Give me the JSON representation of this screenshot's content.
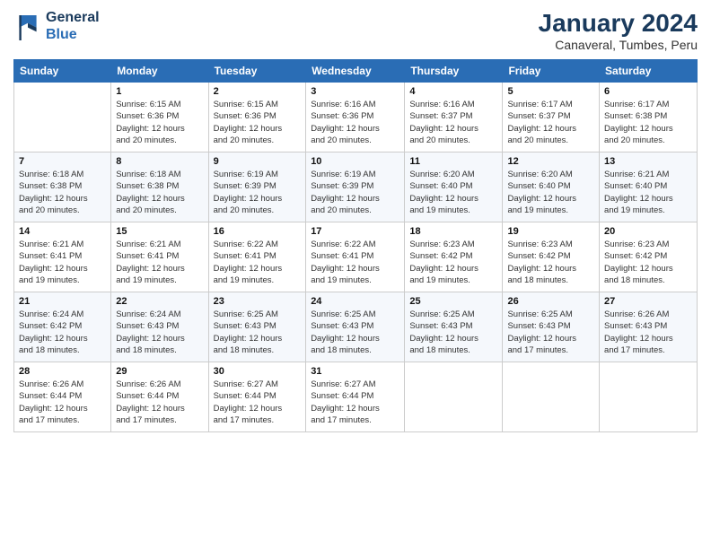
{
  "logo": {
    "line1": "General",
    "line2": "Blue"
  },
  "title": "January 2024",
  "subtitle": "Canaveral, Tumbes, Peru",
  "header_days": [
    "Sunday",
    "Monday",
    "Tuesday",
    "Wednesday",
    "Thursday",
    "Friday",
    "Saturday"
  ],
  "weeks": [
    [
      {
        "day": "",
        "info": ""
      },
      {
        "day": "1",
        "info": "Sunrise: 6:15 AM\nSunset: 6:36 PM\nDaylight: 12 hours\nand 20 minutes."
      },
      {
        "day": "2",
        "info": "Sunrise: 6:15 AM\nSunset: 6:36 PM\nDaylight: 12 hours\nand 20 minutes."
      },
      {
        "day": "3",
        "info": "Sunrise: 6:16 AM\nSunset: 6:36 PM\nDaylight: 12 hours\nand 20 minutes."
      },
      {
        "day": "4",
        "info": "Sunrise: 6:16 AM\nSunset: 6:37 PM\nDaylight: 12 hours\nand 20 minutes."
      },
      {
        "day": "5",
        "info": "Sunrise: 6:17 AM\nSunset: 6:37 PM\nDaylight: 12 hours\nand 20 minutes."
      },
      {
        "day": "6",
        "info": "Sunrise: 6:17 AM\nSunset: 6:38 PM\nDaylight: 12 hours\nand 20 minutes."
      }
    ],
    [
      {
        "day": "7",
        "info": "Sunrise: 6:18 AM\nSunset: 6:38 PM\nDaylight: 12 hours\nand 20 minutes."
      },
      {
        "day": "8",
        "info": "Sunrise: 6:18 AM\nSunset: 6:38 PM\nDaylight: 12 hours\nand 20 minutes."
      },
      {
        "day": "9",
        "info": "Sunrise: 6:19 AM\nSunset: 6:39 PM\nDaylight: 12 hours\nand 20 minutes."
      },
      {
        "day": "10",
        "info": "Sunrise: 6:19 AM\nSunset: 6:39 PM\nDaylight: 12 hours\nand 20 minutes."
      },
      {
        "day": "11",
        "info": "Sunrise: 6:20 AM\nSunset: 6:40 PM\nDaylight: 12 hours\nand 19 minutes."
      },
      {
        "day": "12",
        "info": "Sunrise: 6:20 AM\nSunset: 6:40 PM\nDaylight: 12 hours\nand 19 minutes."
      },
      {
        "day": "13",
        "info": "Sunrise: 6:21 AM\nSunset: 6:40 PM\nDaylight: 12 hours\nand 19 minutes."
      }
    ],
    [
      {
        "day": "14",
        "info": "Sunrise: 6:21 AM\nSunset: 6:41 PM\nDaylight: 12 hours\nand 19 minutes."
      },
      {
        "day": "15",
        "info": "Sunrise: 6:21 AM\nSunset: 6:41 PM\nDaylight: 12 hours\nand 19 minutes."
      },
      {
        "day": "16",
        "info": "Sunrise: 6:22 AM\nSunset: 6:41 PM\nDaylight: 12 hours\nand 19 minutes."
      },
      {
        "day": "17",
        "info": "Sunrise: 6:22 AM\nSunset: 6:41 PM\nDaylight: 12 hours\nand 19 minutes."
      },
      {
        "day": "18",
        "info": "Sunrise: 6:23 AM\nSunset: 6:42 PM\nDaylight: 12 hours\nand 19 minutes."
      },
      {
        "day": "19",
        "info": "Sunrise: 6:23 AM\nSunset: 6:42 PM\nDaylight: 12 hours\nand 18 minutes."
      },
      {
        "day": "20",
        "info": "Sunrise: 6:23 AM\nSunset: 6:42 PM\nDaylight: 12 hours\nand 18 minutes."
      }
    ],
    [
      {
        "day": "21",
        "info": "Sunrise: 6:24 AM\nSunset: 6:42 PM\nDaylight: 12 hours\nand 18 minutes."
      },
      {
        "day": "22",
        "info": "Sunrise: 6:24 AM\nSunset: 6:43 PM\nDaylight: 12 hours\nand 18 minutes."
      },
      {
        "day": "23",
        "info": "Sunrise: 6:25 AM\nSunset: 6:43 PM\nDaylight: 12 hours\nand 18 minutes."
      },
      {
        "day": "24",
        "info": "Sunrise: 6:25 AM\nSunset: 6:43 PM\nDaylight: 12 hours\nand 18 minutes."
      },
      {
        "day": "25",
        "info": "Sunrise: 6:25 AM\nSunset: 6:43 PM\nDaylight: 12 hours\nand 18 minutes."
      },
      {
        "day": "26",
        "info": "Sunrise: 6:25 AM\nSunset: 6:43 PM\nDaylight: 12 hours\nand 17 minutes."
      },
      {
        "day": "27",
        "info": "Sunrise: 6:26 AM\nSunset: 6:43 PM\nDaylight: 12 hours\nand 17 minutes."
      }
    ],
    [
      {
        "day": "28",
        "info": "Sunrise: 6:26 AM\nSunset: 6:44 PM\nDaylight: 12 hours\nand 17 minutes."
      },
      {
        "day": "29",
        "info": "Sunrise: 6:26 AM\nSunset: 6:44 PM\nDaylight: 12 hours\nand 17 minutes."
      },
      {
        "day": "30",
        "info": "Sunrise: 6:27 AM\nSunset: 6:44 PM\nDaylight: 12 hours\nand 17 minutes."
      },
      {
        "day": "31",
        "info": "Sunrise: 6:27 AM\nSunset: 6:44 PM\nDaylight: 12 hours\nand 17 minutes."
      },
      {
        "day": "",
        "info": ""
      },
      {
        "day": "",
        "info": ""
      },
      {
        "day": "",
        "info": ""
      }
    ]
  ]
}
